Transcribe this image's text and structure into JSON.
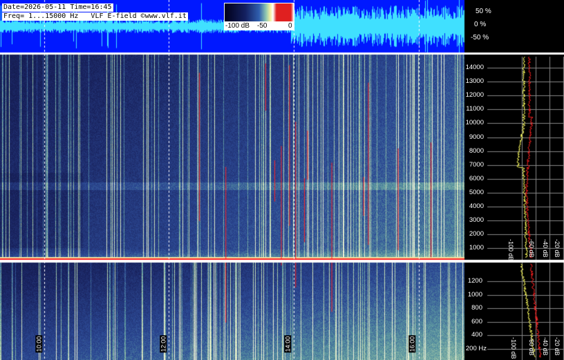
{
  "header": {
    "line1": "Date=2026-05-11 Time=16:45",
    "line2": "Freq= 1...15000 Hz   VLF E-field ©www.vlf.it"
  },
  "colorbar": {
    "min_label": "-100 dB",
    "mid_label": "-50",
    "max_label": "0"
  },
  "amplitude_axis": [
    "50 %",
    "0 %",
    "-50 %"
  ],
  "upper_freq_axis": [
    "14000",
    "13000",
    "12000",
    "11000",
    "10000",
    "9000",
    "8000",
    "7000",
    "6000",
    "5000",
    "4000",
    "3000",
    "2000",
    "1000"
  ],
  "lower_freq_axis": [
    "1200",
    "1000",
    "800",
    "600",
    "400",
    "200 Hz"
  ],
  "db_axis_upper": [
    "-100 dB",
    "-60 dB",
    "-40 dB",
    "-20 dB"
  ],
  "db_axis_lower": [
    "-100 dB",
    "-60 dB",
    "-40 dB",
    "-20 dB"
  ],
  "time_axis": [
    "10:00",
    "12:00",
    "14:00",
    "16:00"
  ],
  "colors": {
    "waveform_bg": "#0018ff",
    "waveform_trace": "#40e0ff",
    "spectrum_white": "#ffff60",
    "spectrum_red": "#ff2020"
  }
}
